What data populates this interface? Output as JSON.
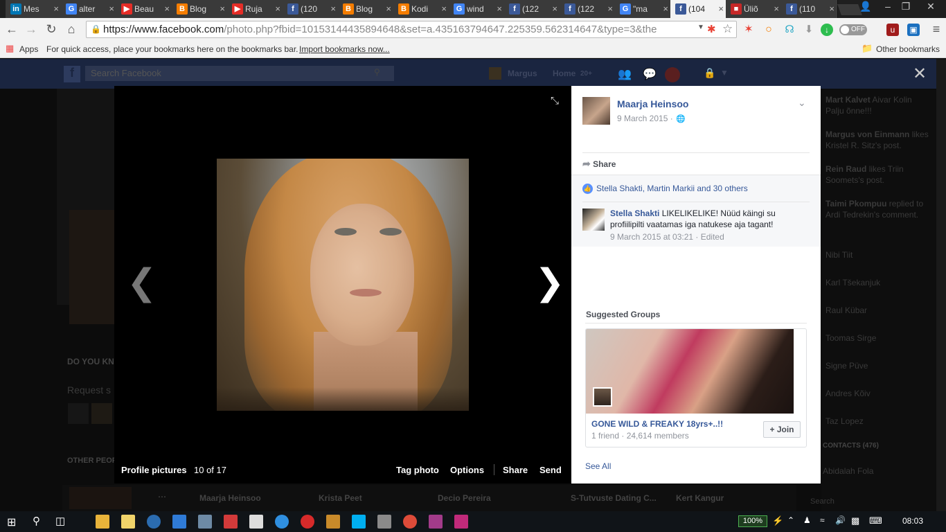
{
  "browser": {
    "tabs": [
      {
        "label": "Mes",
        "favicon": "linkedin-icon",
        "color": "#0077b5",
        "glyph": "in"
      },
      {
        "label": "alter",
        "favicon": "google-icon",
        "color": "#4285f4",
        "glyph": "G"
      },
      {
        "label": "Beau",
        "favicon": "youtube-icon",
        "color": "#e52d27",
        "glyph": "▶"
      },
      {
        "label": "Blog",
        "favicon": "blogger-icon",
        "color": "#f57d00",
        "glyph": "B"
      },
      {
        "label": "Ruja",
        "favicon": "youtube-icon",
        "color": "#e52d27",
        "glyph": "▶"
      },
      {
        "label": "(120",
        "favicon": "facebook-icon",
        "color": "#3b5998",
        "glyph": "f"
      },
      {
        "label": "Blog",
        "favicon": "blogger-icon",
        "color": "#f57d00",
        "glyph": "B"
      },
      {
        "label": "Kodi",
        "favicon": "blogger-icon",
        "color": "#f57d00",
        "glyph": "B"
      },
      {
        "label": "wind",
        "favicon": "google-icon",
        "color": "#4285f4",
        "glyph": "G"
      },
      {
        "label": "(122",
        "favicon": "facebook-icon",
        "color": "#3b5998",
        "glyph": "f"
      },
      {
        "label": "(122",
        "favicon": "facebook-icon",
        "color": "#3b5998",
        "glyph": "f"
      },
      {
        "label": "\"ma",
        "favicon": "google-icon",
        "color": "#4285f4",
        "glyph": "G"
      },
      {
        "label": "(104",
        "favicon": "facebook-icon",
        "color": "#3b5998",
        "glyph": "f",
        "active": true
      },
      {
        "label": "Üliõ",
        "favicon": "site-icon",
        "color": "#c62828",
        "glyph": "■"
      },
      {
        "label": "(110",
        "favicon": "facebook-icon",
        "color": "#3b5998",
        "glyph": "f"
      }
    ],
    "url_host": "https://www.facebook.com",
    "url_path": "/photo.php?fbid=10153144435894648&set=a.435163794647.225359.562314647&type=3&the",
    "toggle_label": "OFF",
    "bookmarks": {
      "apps": "Apps",
      "hint": "For quick access, place your bookmarks here on the bookmarks bar.",
      "import_link": "Import bookmarks now...",
      "other": "Other bookmarks"
    }
  },
  "facebook_bg": {
    "search_placeholder": "Search Facebook",
    "user_name": "Margus",
    "home_label": "Home",
    "home_count": "20+",
    "left_texts": [
      "DO YOU KNO",
      "Request s",
      "OTHER PEOP"
    ],
    "ticker": [
      {
        "name": "Mart Kalvet",
        "text": "Aivar Kolin Palju õnne!!!"
      },
      {
        "name": "Margus von Einmann",
        "text": "likes Kristel R. Sitz's post."
      },
      {
        "name": "Rein Raud",
        "text": "likes Triin Soomets's post."
      },
      {
        "name": "Taimi Pkompuu",
        "text": "replied to Ardi Tedrekin's comment."
      }
    ],
    "contacts": [
      "Nibi Tiit",
      "Karl Tšekanjuk",
      "Raul Kübar",
      "Toomas Sirge",
      "Signe Püve",
      "Andres Kõiv",
      "Taz Lopez"
    ],
    "contacts_header": "CONTACTS (476)",
    "contact_last": "Abidalah Fola",
    "chat_tabs": [
      "Maarja Heinsoo",
      "Krista Peet",
      "Decio Pereira",
      "S-Tutvuste Dating C...",
      "Kert Kangur"
    ],
    "chat_search": "Search"
  },
  "theater": {
    "album_caption": "Profile pictures",
    "position_text": "10 of 17",
    "actions": {
      "tag": "Tag photo",
      "options": "Options",
      "share": "Share",
      "send": "Send"
    }
  },
  "panel": {
    "author": "Maarja Heinsoo",
    "date": "9 March 2015 · ",
    "privacy_icon": "globe-icon",
    "share_label": "Share",
    "likers": "Stella Shakti, Martin Markii and 30 others",
    "comment": {
      "author": "Stella Shakti",
      "text": " LIKELIKELIKE! Nüüd käingi su profiilipilti vaatamas iga natukese aja tagant!",
      "meta": "9 March 2015 at 03:21 · Edited"
    },
    "suggested_title": "Suggested Groups",
    "group": {
      "name": "GONE WILD & FREAKY 18yrs+..!!",
      "meta": "1 friend · 24,614 members",
      "join_label": "+ Join"
    },
    "see_all": "See All"
  },
  "taskbar": {
    "battery": "100%",
    "time": "08:03"
  }
}
